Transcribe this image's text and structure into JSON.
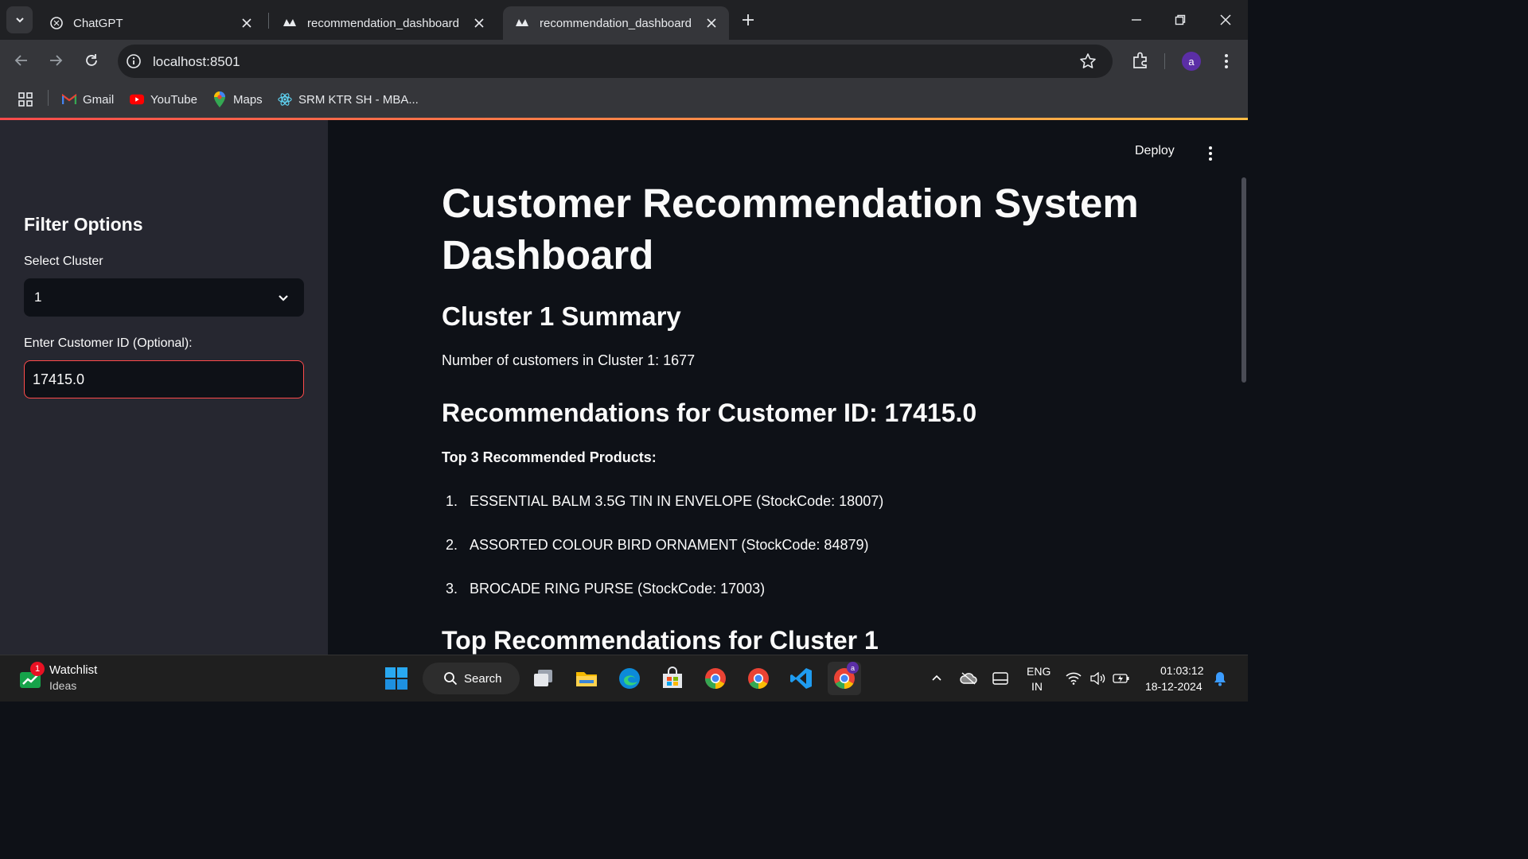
{
  "browser": {
    "tabs": [
      {
        "title": "ChatGPT",
        "active": false
      },
      {
        "title": "recommendation_dashboard",
        "active": false
      },
      {
        "title": "recommendation_dashboard",
        "active": true
      }
    ],
    "url": "localhost:8501",
    "profile_initial": "a",
    "bookmarks": [
      {
        "label": "Gmail",
        "icon": "gmail-icon"
      },
      {
        "label": "YouTube",
        "icon": "youtube-icon"
      },
      {
        "label": "Maps",
        "icon": "maps-icon"
      },
      {
        "label": "SRM KTR SH - MBA...",
        "icon": "react-icon"
      }
    ]
  },
  "app": {
    "deploy_label": "Deploy",
    "sidebar": {
      "title": "Filter Options",
      "cluster_label": "Select Cluster",
      "cluster_value": "1",
      "customer_label": "Enter Customer ID (Optional):",
      "customer_value": "17415.0"
    },
    "main": {
      "title": "Customer Recommendation System Dashboard",
      "cluster_summary_heading": "Cluster 1 Summary",
      "customer_count_text": "Number of customers in Cluster 1: 1677",
      "recommendations_heading": "Recommendations for Customer ID: 17415.0",
      "top_products_label": "Top 3 Recommended Products:",
      "recommendations": [
        {
          "num": "1.",
          "text": "ESSENTIAL BALM 3.5G TIN IN ENVELOPE (StockCode: 18007)"
        },
        {
          "num": "2.",
          "text": "ASSORTED COLOUR BIRD ORNAMENT (StockCode: 84879)"
        },
        {
          "num": "3.",
          "text": "BROCADE RING PURSE (StockCode: 17003)"
        }
      ],
      "cluster_top_heading": "Top Recommendations for Cluster 1"
    }
  },
  "taskbar": {
    "watchlist_title": "Watchlist",
    "watchlist_sub": "Ideas",
    "watchlist_badge": "1",
    "search_label": "Search",
    "language_top": "ENG",
    "language_bottom": "IN",
    "time": "01:03:12",
    "date": "18-12-2024",
    "chrome_profile_badge": "a"
  },
  "colors": {
    "accent": "#ff4b4b",
    "sidebar_bg": "#262730",
    "main_bg": "#0e1117",
    "browser_frame": "#202124",
    "toolbar": "#35363a"
  }
}
